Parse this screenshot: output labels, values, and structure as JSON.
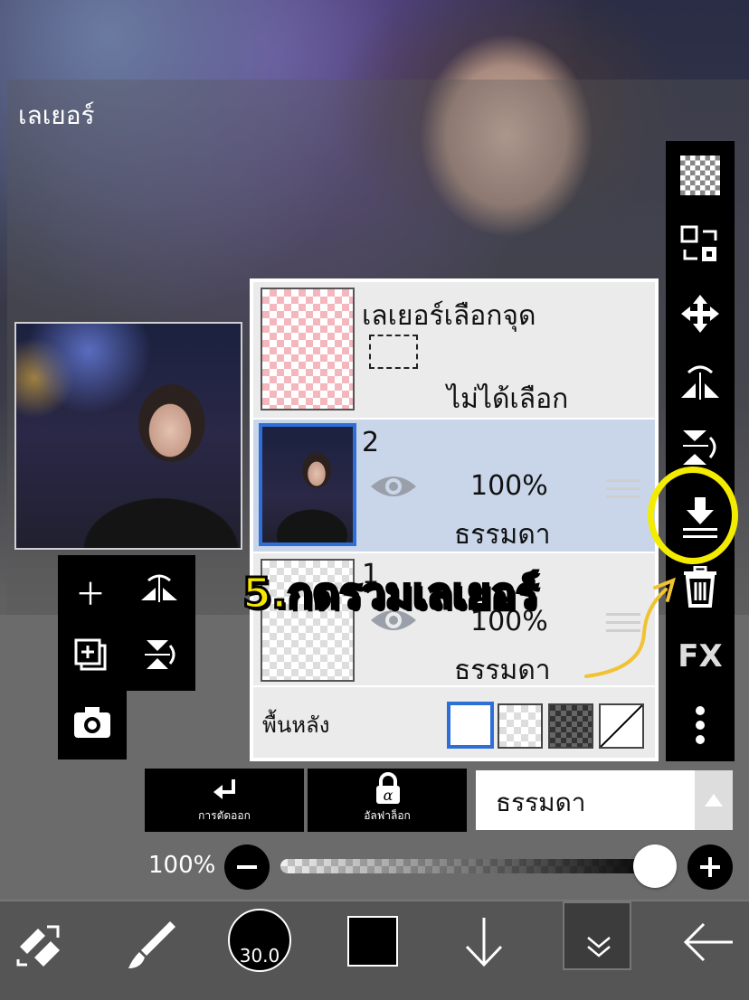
{
  "header": {
    "title": "เลเยอร์"
  },
  "layers_panel": {
    "selection_layer": {
      "name": "เลเยอร์เลือกจุด",
      "status": "ไม่ได้เลือก"
    },
    "layers": [
      {
        "number": "2",
        "opacity": "100%",
        "blend": "ธรรมดา",
        "selected": true
      },
      {
        "number": "1",
        "opacity": "100%",
        "blend": "ธรรมดา",
        "selected": false
      }
    ],
    "background": {
      "label": "พื้นหลัง"
    }
  },
  "actions": {
    "clip_label": "การตัดออก",
    "alpha_lock_label": "อัลฟาล็อก"
  },
  "blend_mode": {
    "value": "ธรรมดา"
  },
  "opacity_slider": {
    "value_text": "100%",
    "fraction": 1.0
  },
  "bottom_toolbar": {
    "brush_size": "30.0",
    "color": "#000000"
  },
  "right_toolbar": {
    "fx_label": "FX"
  },
  "annotation": {
    "text": "5.กดรวมเลเยอร์",
    "color": "#f7e600"
  },
  "colors": {
    "selected_row": "#c9d6ea",
    "accent_blue": "#2d6fd6",
    "highlight": "#f4ec00"
  }
}
